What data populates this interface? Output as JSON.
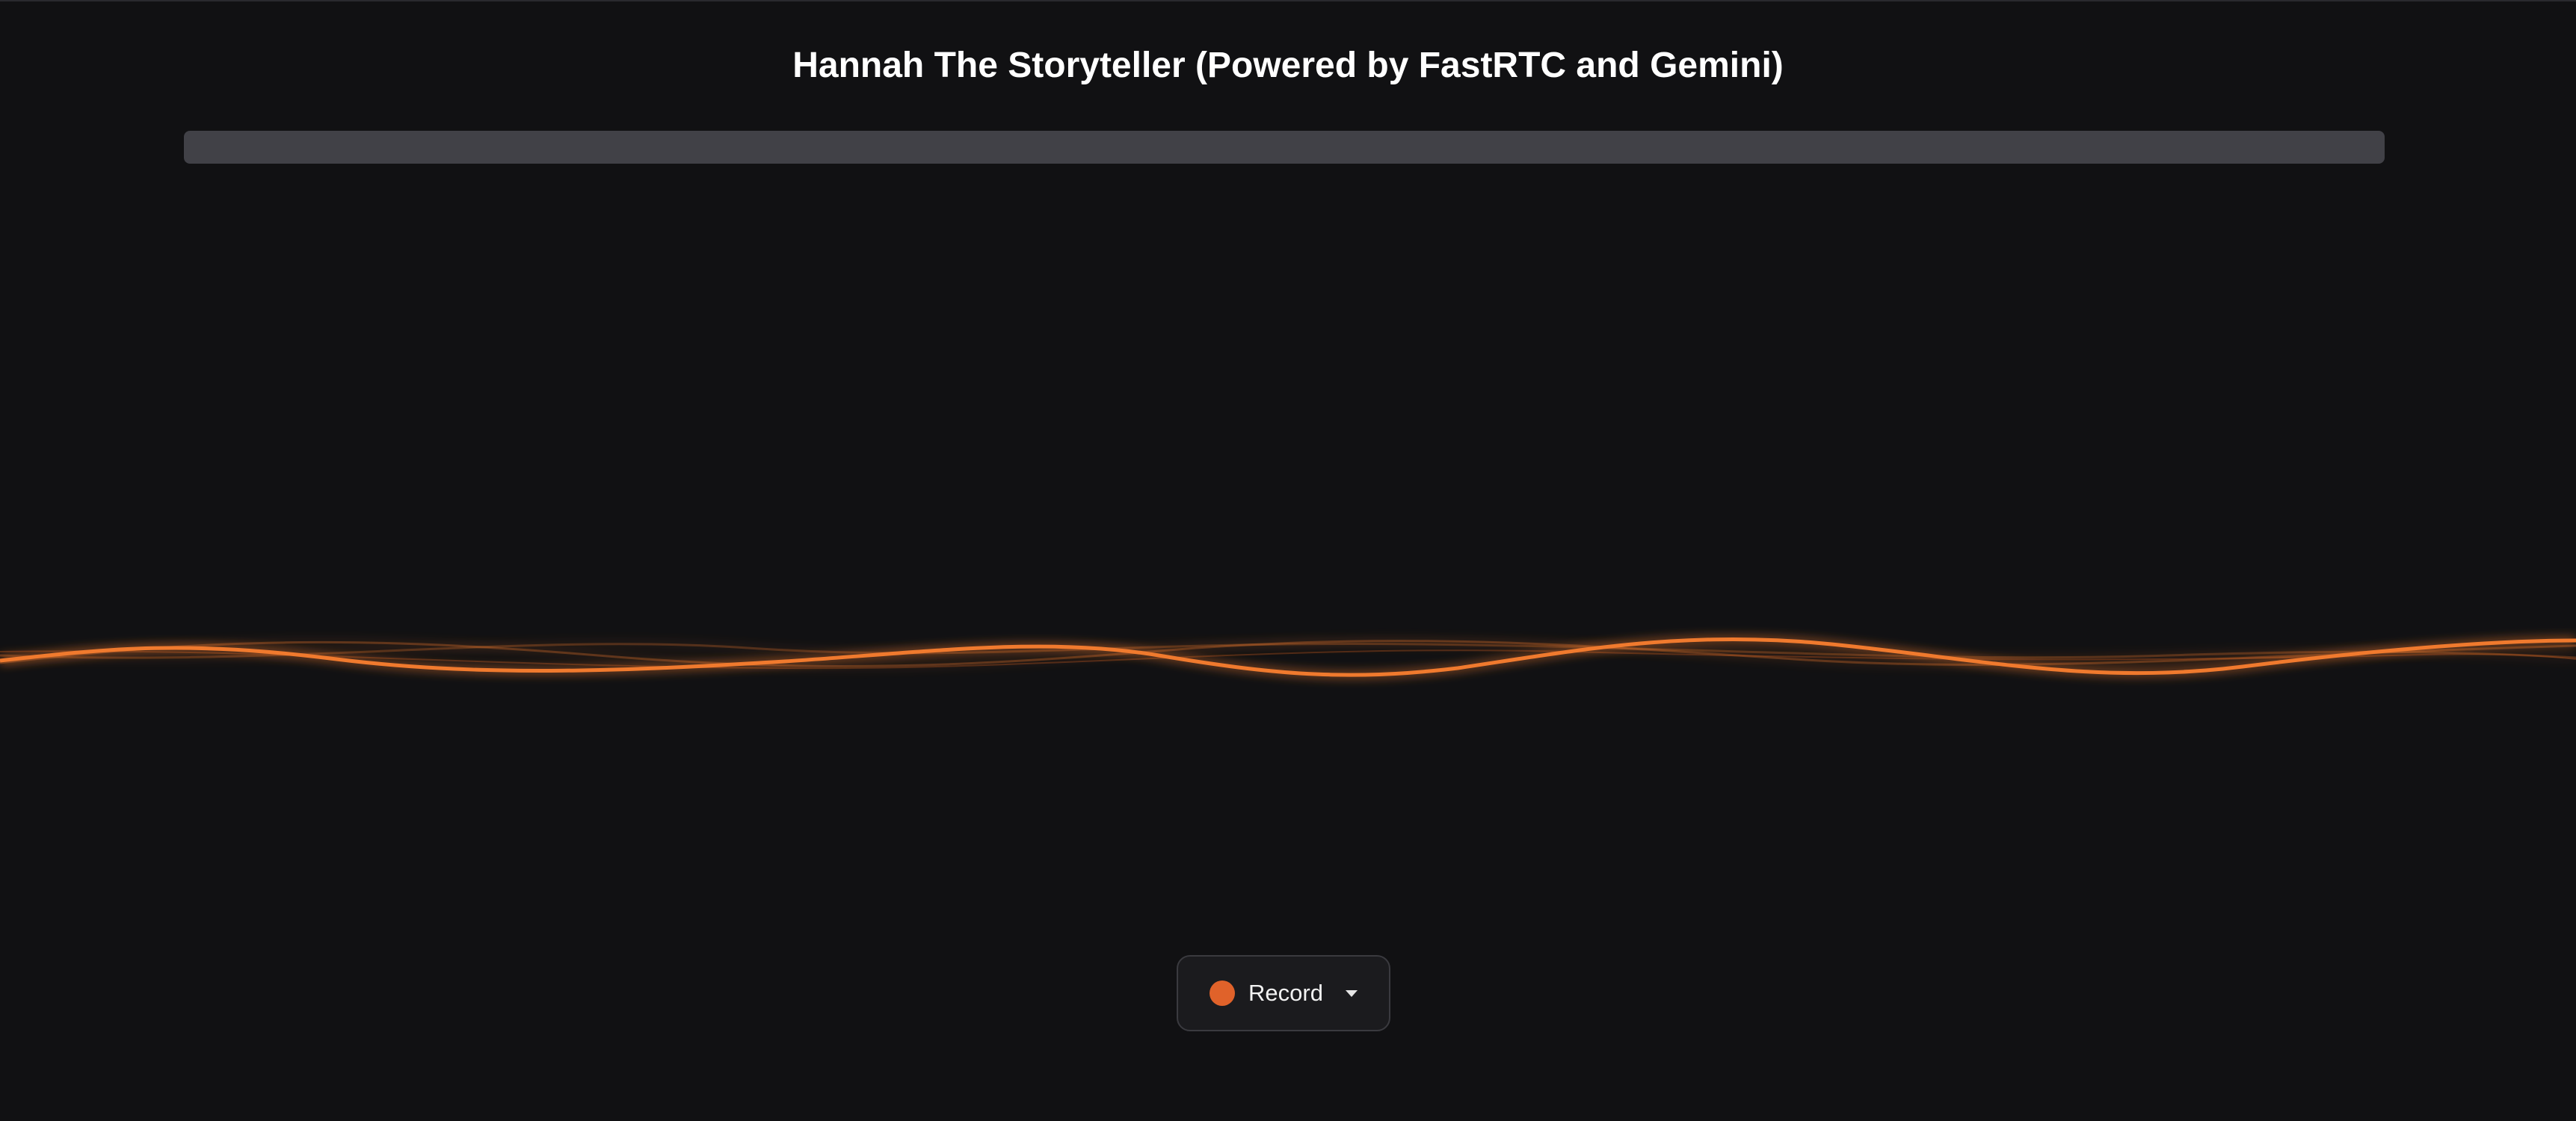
{
  "header": {
    "title": "Hannah The Storyteller (Powered by FastRTC and Gemini)"
  },
  "controls": {
    "record_label": "Record"
  },
  "colors": {
    "background": "#111113",
    "accent": "#e0622a",
    "wave": "#f07a2e"
  },
  "icons": {
    "record": "record-dot-icon",
    "dropdown": "chevron-down-icon"
  }
}
